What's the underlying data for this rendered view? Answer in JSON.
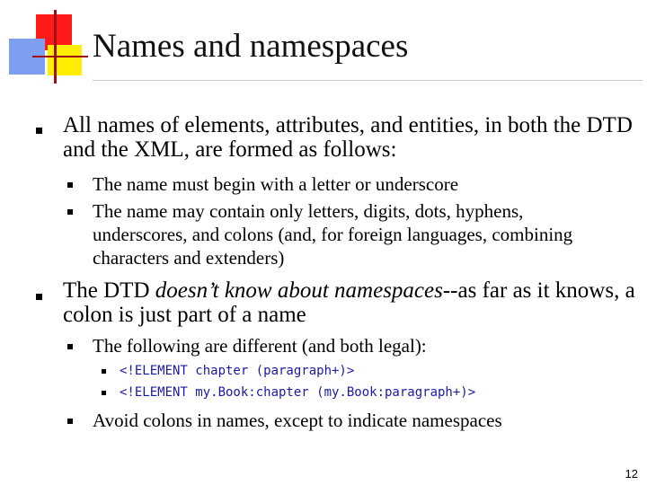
{
  "slide": {
    "title": "Names and namespaces",
    "page_number": "12",
    "bullets": [
      {
        "text": "All names of elements, attributes, and entities, in both the DTD and the XML, are formed as follows:",
        "sub": [
          "The name must begin with a letter or underscore",
          "The name may contain only letters, digits, dots, hyphens, underscores, and colons (and, for foreign languages, combining characters and extenders)"
        ]
      },
      {
        "text_pre": "The DTD ",
        "text_italic": "doesn’t know about namespaces",
        "text_post": "--as far as it knows, a colon is just part of a name",
        "sub": [
          {
            "text": "The following are different (and both legal):",
            "code": [
              "<!ELEMENT chapter (paragraph+)>",
              "<!ELEMENT my.Book:chapter (my.Book:paragraph+)>"
            ]
          },
          {
            "text": "Avoid colons in names, except to indicate namespaces"
          }
        ]
      }
    ]
  }
}
